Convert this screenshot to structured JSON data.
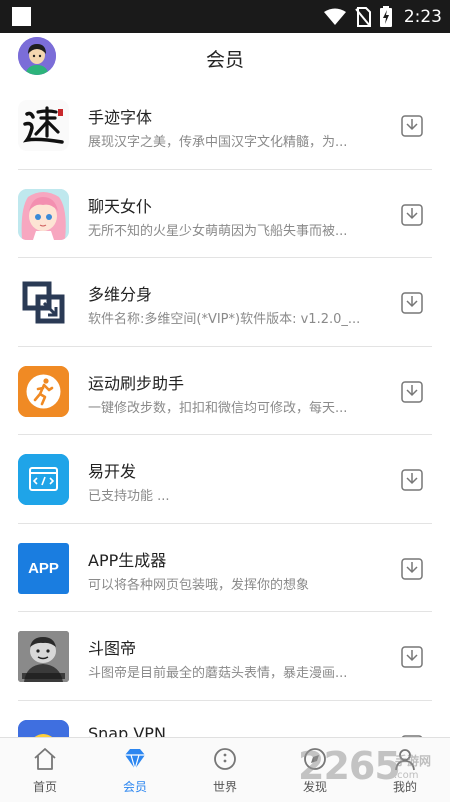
{
  "status_bar": {
    "time": "2:23"
  },
  "header": {
    "title": "会员"
  },
  "apps": [
    {
      "name": "手迹字体",
      "desc": "展现汉字之美，传承中国汉字文化精髓，为...",
      "icon": "calligraphy-icon"
    },
    {
      "name": "聊天女仆",
      "desc": "无所不知的火星少女萌萌因为飞船失事而被...",
      "icon": "anime-girl-icon"
    },
    {
      "name": "多维分身",
      "desc": "软件名称:多维空间(*VIP*)软件版本: v1.2.0_...",
      "icon": "parallel-space-icon"
    },
    {
      "name": "运动刷步助手",
      "desc": "一键修改步数，扣扣和微信均可修改，每天...",
      "icon": "running-man-icon"
    },
    {
      "name": "易开发",
      "desc": "已支持功能 ...",
      "icon": "code-window-icon"
    },
    {
      "name": "APP生成器",
      "desc": "可以将各种网页包装哦，发挥你的想象",
      "icon": "app-generator-icon",
      "icon_text": "APP"
    },
    {
      "name": "斗图帝",
      "desc": "斗图帝是目前最全的蘑菇头表情，暴走漫画...",
      "icon": "meme-icon"
    },
    {
      "name": "Snap VPN",
      "desc": "",
      "icon": "vpn-icon"
    }
  ],
  "tabs": [
    {
      "label": "首页",
      "icon": "home-icon",
      "active": false
    },
    {
      "label": "会员",
      "icon": "diamond-icon",
      "active": true
    },
    {
      "label": "世界",
      "icon": "globe-icon",
      "active": false
    },
    {
      "label": "发现",
      "icon": "discover-icon",
      "active": false
    },
    {
      "label": "我的",
      "icon": "profile-icon",
      "active": false
    }
  ],
  "watermark": {
    "text": "2265",
    "sub": "手游网",
    "sub2": ".com"
  },
  "colors": {
    "accent": "#2c86f0",
    "status_bar": "#1a1a1a",
    "separator": "#e3e3e3",
    "desc_text": "#8a8a8a"
  }
}
